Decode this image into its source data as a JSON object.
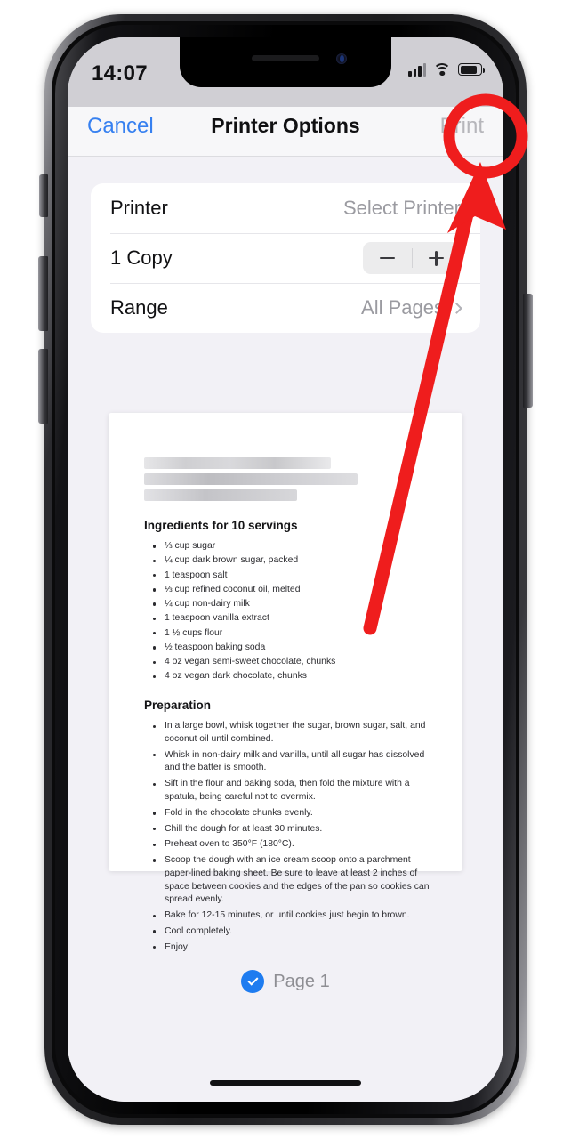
{
  "status_bar": {
    "time": "14:07",
    "icons": [
      "cellular-signal-icon",
      "wifi-icon",
      "battery-icon"
    ]
  },
  "navbar": {
    "cancel_label": "Cancel",
    "title": "Printer Options",
    "print_label": "Print",
    "print_disabled": true
  },
  "options": {
    "rows": [
      {
        "label": "Printer",
        "value": "Select Printer",
        "control": "chevron"
      },
      {
        "label": "1 Copy",
        "value": "",
        "control": "stepper"
      },
      {
        "label": "Range",
        "value": "All Pages",
        "control": "chevron"
      }
    ]
  },
  "preview": {
    "document": {
      "title_redacted": true,
      "ingredients_heading": "Ingredients for 10 servings",
      "ingredients": [
        "⅓ cup sugar",
        "¼ cup dark brown sugar, packed",
        "1 teaspoon salt",
        "⅓ cup refined coconut oil, melted",
        "¼ cup non-dairy milk",
        "1 teaspoon vanilla extract",
        "1 ½ cups flour",
        "½ teaspoon baking soda",
        "4 oz vegan semi-sweet chocolate, chunks",
        "4 oz vegan dark chocolate, chunks"
      ],
      "preparation_heading": "Preparation",
      "preparation": [
        "In a large bowl, whisk together the sugar, brown sugar, salt, and coconut oil until combined.",
        "Whisk in non-dairy milk and vanilla, until all sugar has dissolved and the batter is smooth.",
        "Sift in the flour and baking soda, then fold the mixture with a spatula, being careful not to overmix.",
        "Fold in the chocolate chunks evenly.",
        "Chill the dough for at least 30 minutes.",
        "Preheat oven to 350°F (180°C).",
        "Scoop the dough with an ice cream scoop onto a parchment paper-lined baking sheet. Be sure to leave at least 2 inches of space between cookies and the edges of the pan so cookies can spread evenly.",
        "Bake for 12-15 minutes, or until cookies just begin to brown.",
        "Cool completely.",
        "Enjoy!"
      ]
    },
    "page_label": "Page 1",
    "page_selected": true
  },
  "annotation": {
    "highlight_color": "#ef1d1d",
    "shapes": [
      "circle-highlight",
      "arrow-pointer"
    ],
    "target": "Print"
  },
  "colors": {
    "accent_blue": "#3680f0",
    "check_blue": "#1e7cf0",
    "screen_bg": "#f2f1f6",
    "annotation_red": "#ef1d1d"
  }
}
